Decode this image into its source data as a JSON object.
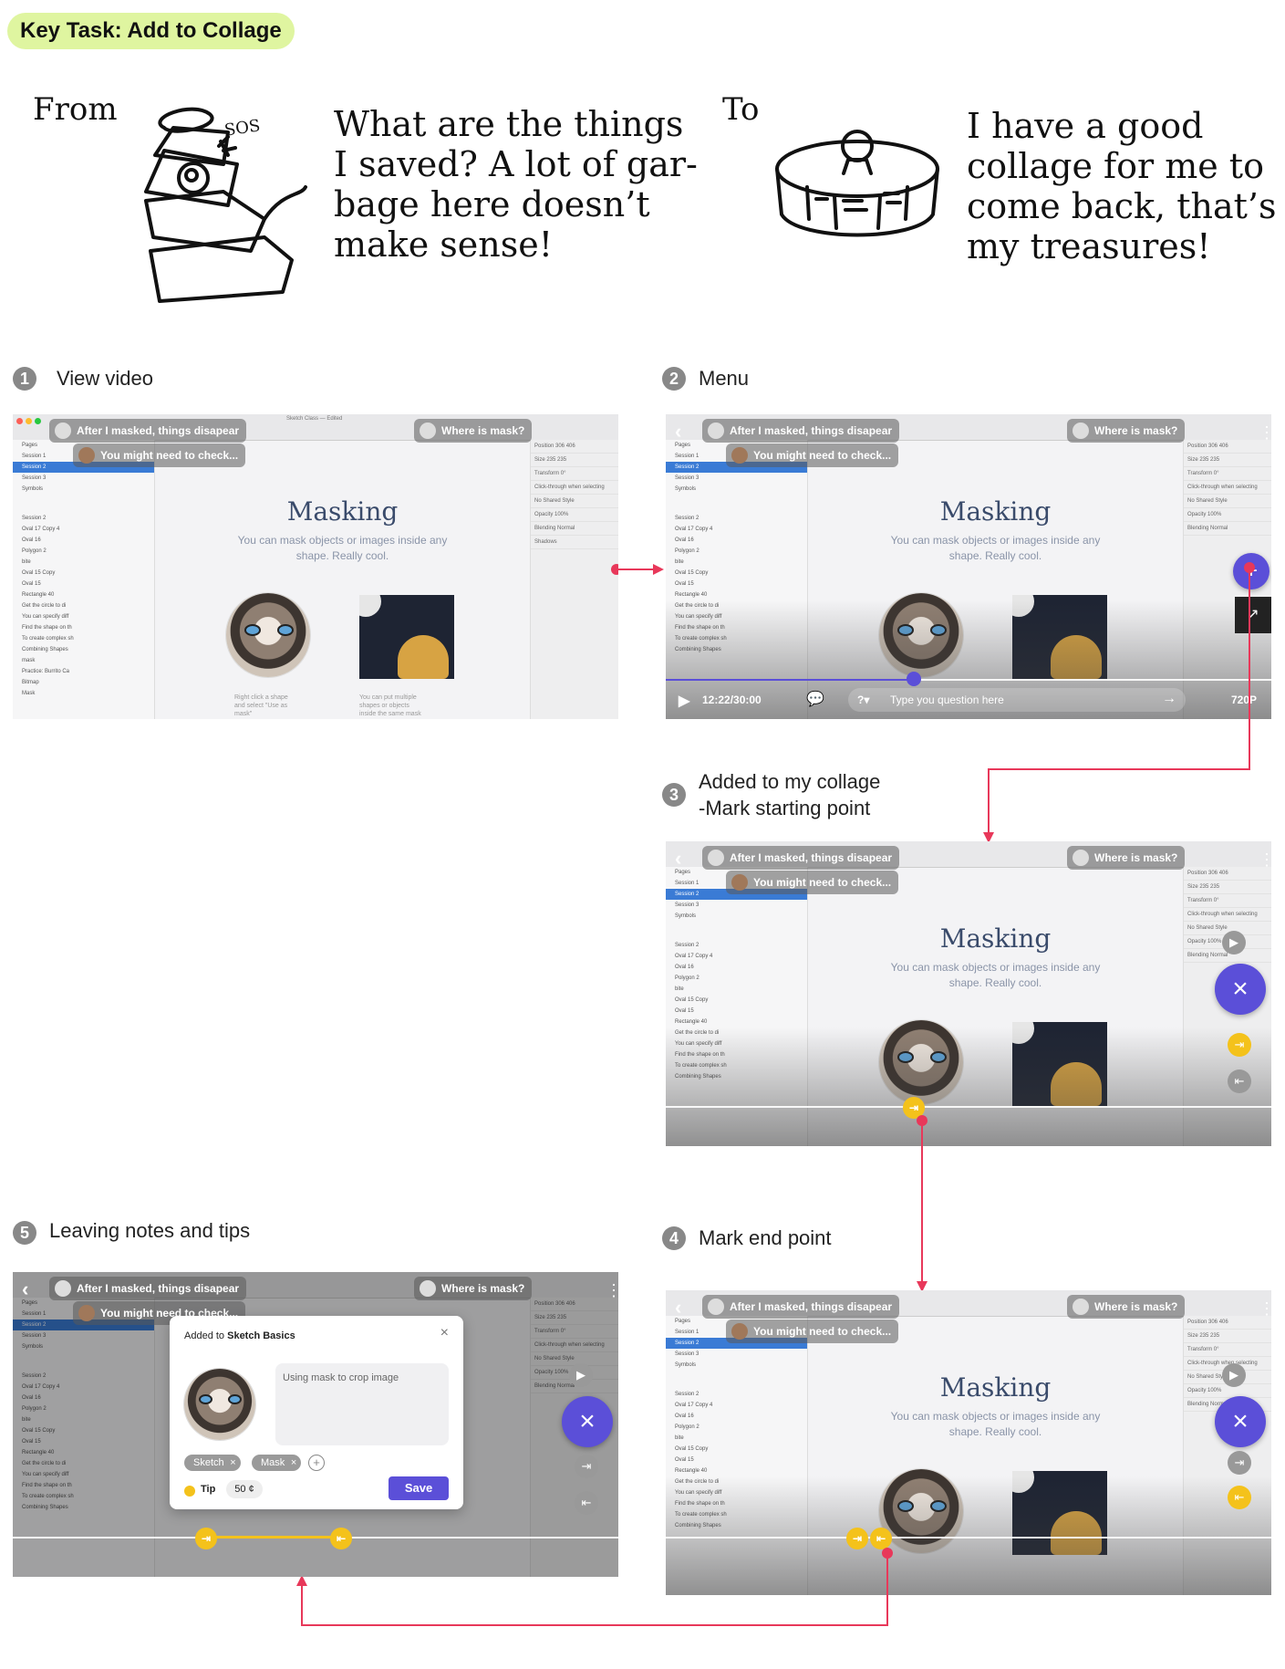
{
  "key_task": "Key Task: Add to Collage",
  "from_label": "From",
  "from_quote": [
    "What  are the things",
    "I saved? A lot of gar-",
    "bage here doesn’t",
    "make sense!"
  ],
  "sos_text": "SOS",
  "to_label": "To",
  "to_quote": [
    "I have a good",
    "collage for me to",
    "come back, that’s",
    "my treasures!"
  ],
  "steps": [
    {
      "num": "1",
      "title": "View video"
    },
    {
      "num": "2",
      "title": "Menu"
    },
    {
      "num": "3",
      "title": "Added to my collage",
      "subtitle": "-Mark starting point"
    },
    {
      "num": "4",
      "title": "Mark end point"
    },
    {
      "num": "5",
      "title": "Leaving notes and tips"
    }
  ],
  "screen": {
    "app_title": "Sketch Class — Edited",
    "pages_label": "Pages",
    "sessions": [
      "Session 1",
      "Session 2",
      "Session 3",
      "Symbols"
    ],
    "session2_header": "Session 2",
    "layers": [
      "Oval 17 Copy 4",
      "Oval 16",
      "Polygon 2",
      "bite",
      "Oval 15 Copy",
      "Oval 15",
      "Rectangle 40",
      "Get the circle to di",
      "You can specify diff",
      "Find the shape on th",
      "To create complex sh",
      "Combining Shapes",
      "mask",
      "Practice: Burrito Ca",
      "Bitmap",
      "Mask"
    ],
    "right_rows": [
      "Position  306  406",
      "Size  235  235",
      "Transform  0°",
      "Click-through when selecting",
      "No Shared Style",
      "Opacity  100%",
      "Blending  Normal",
      "Shadows"
    ],
    "canvas_title": "Masking",
    "canvas_sub": [
      "You can mask objects or images inside any",
      "shape. Really cool."
    ],
    "caption_left": [
      "Right click a shape",
      "and select \"Use as",
      "mask\""
    ],
    "caption_right": [
      "You can put multiple",
      "shapes or objects",
      "inside the same mask"
    ],
    "question_1": "After I masked, things disapear",
    "question_2": "Where is mask?",
    "question_3": "You might need to check...",
    "time": "12:22/30:00",
    "ask_placeholder": "Type you question here",
    "quality": "720P"
  },
  "popup": {
    "added_to": "Added to",
    "collection": "Sketch Basics",
    "close": "×",
    "note": "Using mask to crop image",
    "tags": [
      "Sketch",
      "Mask"
    ],
    "tip_label": "Tip",
    "tip_value": "50 ¢",
    "save": "Save"
  },
  "colors": {
    "accent": "#5b4fd8",
    "connector": "#e8385a",
    "marker": "#f4c21b",
    "tag_bg": "#dff5a0"
  }
}
